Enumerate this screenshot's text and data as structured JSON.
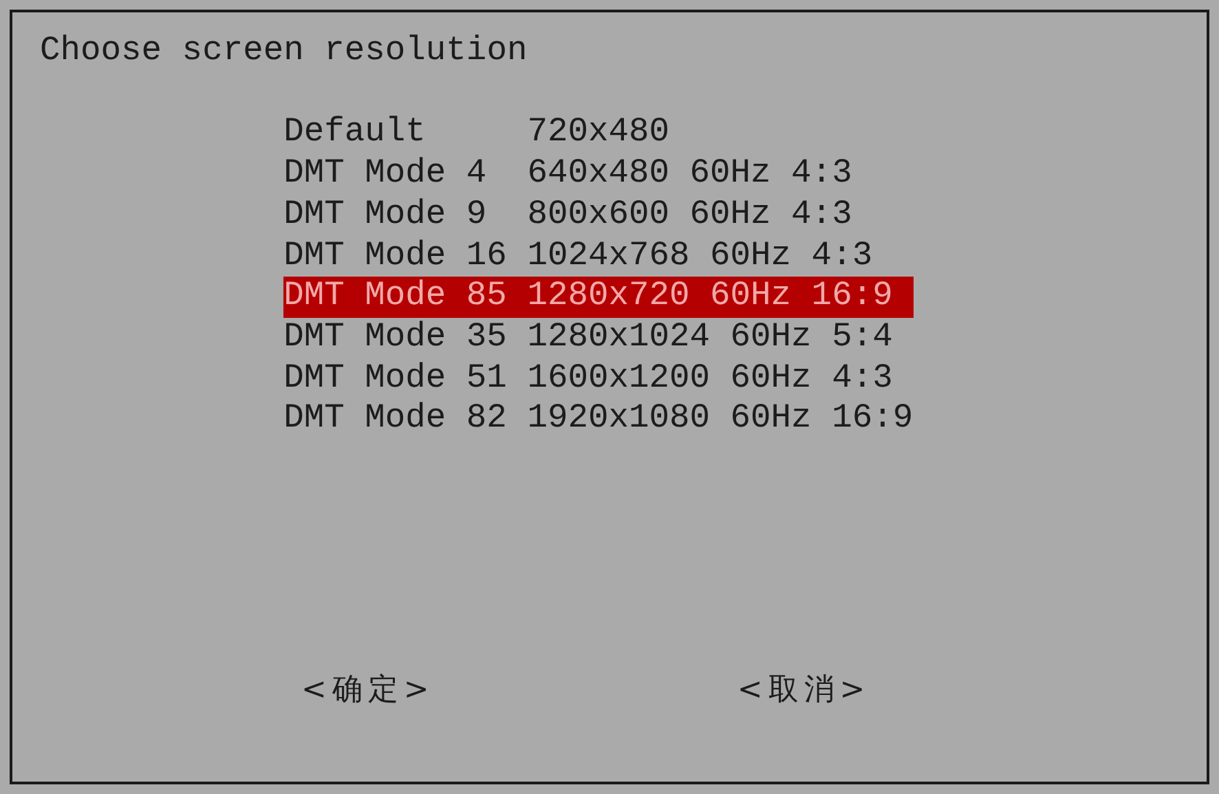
{
  "dialog": {
    "title": "Choose screen resolution"
  },
  "menu": [
    {
      "tag": "Default",
      "description": "720x480",
      "selected": false
    },
    {
      "tag": "DMT Mode 4",
      "description": "640x480 60Hz 4:3",
      "selected": false
    },
    {
      "tag": "DMT Mode 9",
      "description": "800x600 60Hz 4:3",
      "selected": false
    },
    {
      "tag": "DMT Mode 16",
      "description": "1024x768 60Hz 4:3",
      "selected": false
    },
    {
      "tag": "DMT Mode 85",
      "description": "1280x720 60Hz 16:9",
      "selected": true
    },
    {
      "tag": "DMT Mode 35",
      "description": "1280x1024 60Hz 5:4",
      "selected": false
    },
    {
      "tag": "DMT Mode 51",
      "description": "1600x1200 60Hz 4:3",
      "selected": false
    },
    {
      "tag": "DMT Mode 82",
      "description": "1920x1080 60Hz 16:9",
      "selected": false
    }
  ],
  "buttons": [
    "<确定>",
    "<取消>"
  ]
}
